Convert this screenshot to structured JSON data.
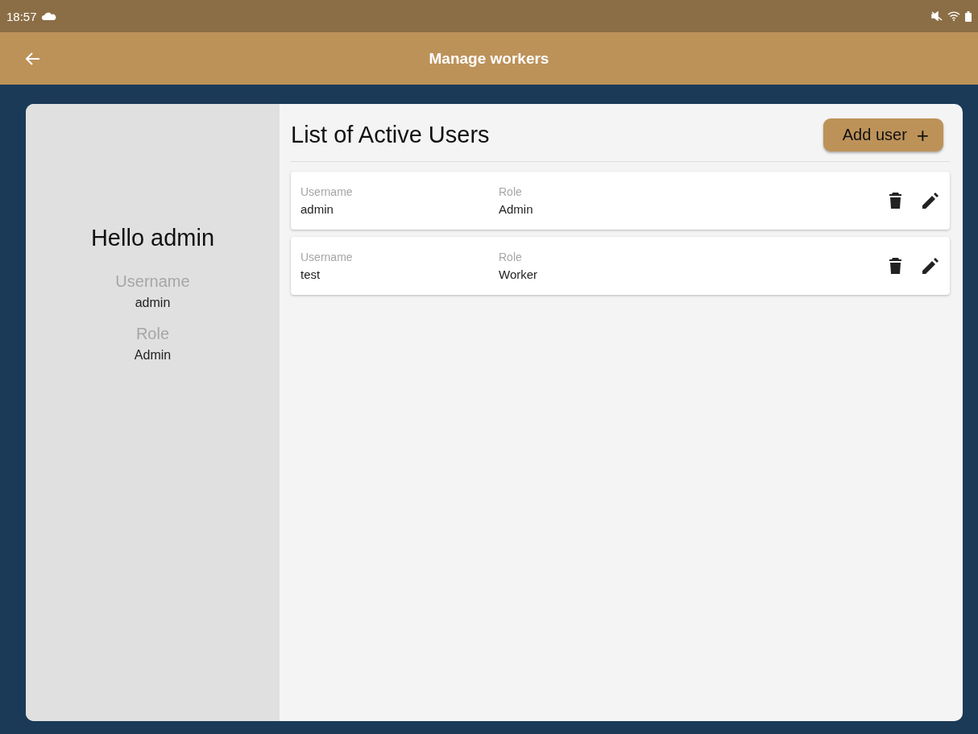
{
  "status_bar": {
    "time": "18:57"
  },
  "app_bar": {
    "title": "Manage workers"
  },
  "profile": {
    "greeting": "Hello admin",
    "fields": [
      {
        "label": "Username",
        "value": "admin"
      },
      {
        "label": "Role",
        "value": "Admin"
      }
    ]
  },
  "users_panel": {
    "title": "List of Active Users",
    "add_button": {
      "label": "Add user",
      "icon": "+"
    },
    "users": [
      {
        "username_label": "Username",
        "username": "admin",
        "role_label": "Role",
        "role": "Admin"
      },
      {
        "username_label": "Username",
        "username": "test",
        "role_label": "Role",
        "role": "Worker"
      }
    ]
  }
}
